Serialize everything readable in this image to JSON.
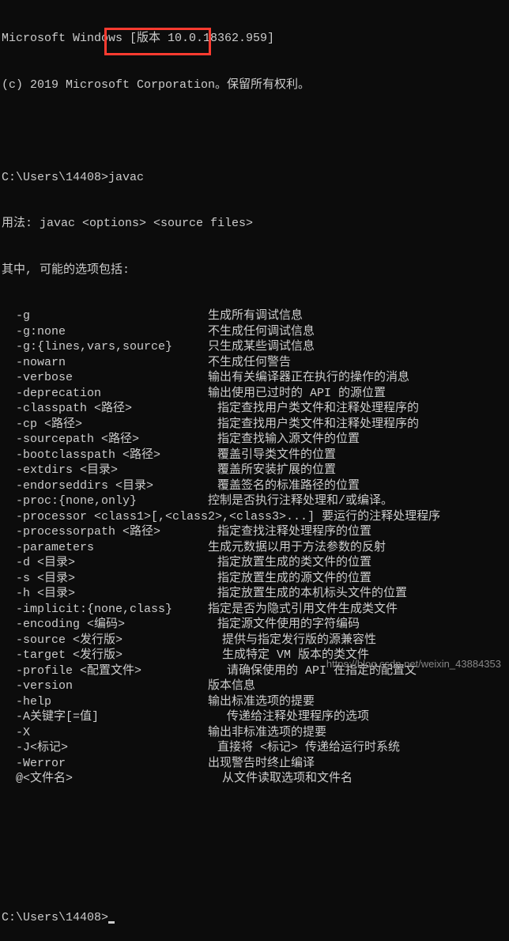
{
  "header": {
    "line1": "Microsoft Windows [版本 10.0.18362.959]",
    "line2": "(c) 2019 Microsoft Corporation。保留所有权利。"
  },
  "prompt1": {
    "path": "C:\\Users\\14408>",
    "command": "javac"
  },
  "usage": {
    "line1": "用法: javac <options> <source files>",
    "line2": "其中, 可能的选项包括:"
  },
  "options": [
    {
      "flag": "  -g                         ",
      "desc": "生成所有调试信息"
    },
    {
      "flag": "  -g:none                    ",
      "desc": "不生成任何调试信息"
    },
    {
      "flag": "  -g:{lines,vars,source}     ",
      "desc": "只生成某些调试信息"
    },
    {
      "flag": "  -nowarn                    ",
      "desc": "不生成任何警告"
    },
    {
      "flag": "  -verbose                   ",
      "desc": "输出有关编译器正在执行的操作的消息"
    },
    {
      "flag": "  -deprecation               ",
      "desc": "输出使用已过时的 API 的源位置"
    },
    {
      "flag": "  -classpath <路径>            ",
      "desc": "指定查找用户类文件和注释处理程序的"
    },
    {
      "flag": "  -cp <路径>                   ",
      "desc": "指定查找用户类文件和注释处理程序的"
    },
    {
      "flag": "  -sourcepath <路径>           ",
      "desc": "指定查找输入源文件的位置"
    },
    {
      "flag": "  -bootclasspath <路径>        ",
      "desc": "覆盖引导类文件的位置"
    },
    {
      "flag": "  -extdirs <目录>              ",
      "desc": "覆盖所安装扩展的位置"
    },
    {
      "flag": "  -endorseddirs <目录>         ",
      "desc": "覆盖签名的标准路径的位置"
    },
    {
      "flag": "  -proc:{none,only}          ",
      "desc": "控制是否执行注释处理和/或编译。"
    },
    {
      "flag": "  -processor <class1>[,<class2>,<class3>...] ",
      "desc": "要运行的注释处理程序"
    },
    {
      "flag": "  -processorpath <路径>        ",
      "desc": "指定查找注释处理程序的位置"
    },
    {
      "flag": "  -parameters                ",
      "desc": "生成元数据以用于方法参数的反射"
    },
    {
      "flag": "  -d <目录>                    ",
      "desc": "指定放置生成的类文件的位置"
    },
    {
      "flag": "  -s <目录>                    ",
      "desc": "指定放置生成的源文件的位置"
    },
    {
      "flag": "  -h <目录>                    ",
      "desc": "指定放置生成的本机标头文件的位置"
    },
    {
      "flag": "  -implicit:{none,class}     ",
      "desc": "指定是否为隐式引用文件生成类文件"
    },
    {
      "flag": "  -encoding <编码>             ",
      "desc": "指定源文件使用的字符编码"
    },
    {
      "flag": "  -source <发行版>              ",
      "desc": "提供与指定发行版的源兼容性"
    },
    {
      "flag": "  -target <发行版>              ",
      "desc": "生成特定 VM 版本的类文件"
    },
    {
      "flag": "  -profile <配置文件>            ",
      "desc": "请确保使用的 API 在指定的配置文"
    },
    {
      "flag": "  -version                   ",
      "desc": "版本信息"
    },
    {
      "flag": "  -help                      ",
      "desc": "输出标准选项的提要"
    },
    {
      "flag": "  -A关键字[=值]                  ",
      "desc": "传递给注释处理程序的选项"
    },
    {
      "flag": "  -X                         ",
      "desc": "输出非标准选项的提要"
    },
    {
      "flag": "  -J<标记>                     ",
      "desc": "直接将 <标记> 传递给运行时系统"
    },
    {
      "flag": "  -Werror                    ",
      "desc": "出现警告时终止编译"
    },
    {
      "flag": "  @<文件名>                     ",
      "desc": "从文件读取选项和文件名"
    }
  ],
  "prompt2": {
    "path": "C:\\Users\\14408>"
  },
  "watermark": "https://blog.csdn.net/weixin_43884353"
}
